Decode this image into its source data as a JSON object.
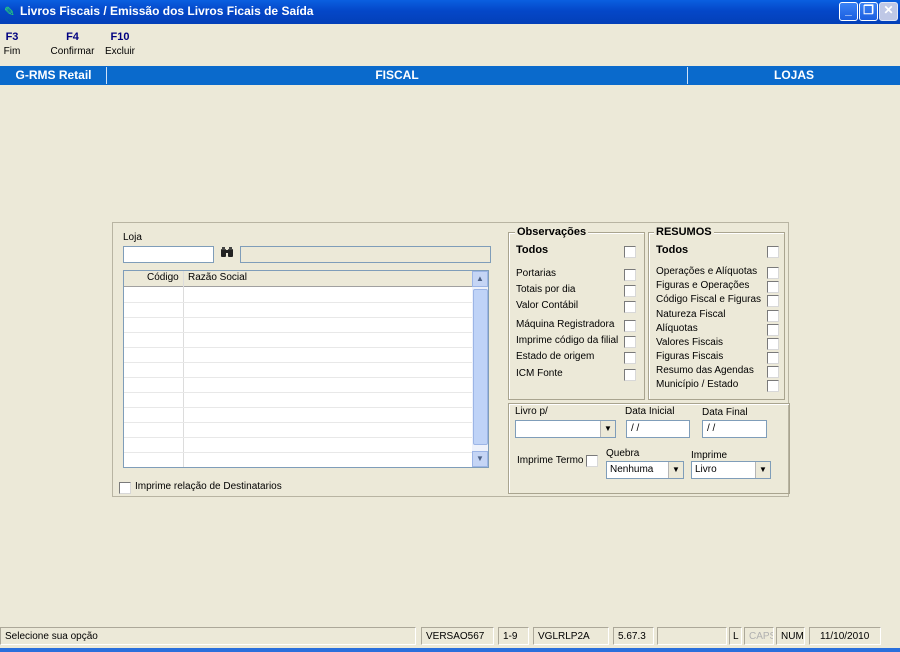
{
  "window": {
    "title": "Livros Fiscais / Emissão dos Livros Ficais de Saída",
    "buttons": {
      "minimize": "_",
      "restore": "❐",
      "close": "✕"
    }
  },
  "toolbar": [
    {
      "key": "F3",
      "label": "Fim"
    },
    {
      "key": "F4",
      "label": "Confirmar"
    },
    {
      "key": "F10",
      "label": "Excluir"
    }
  ],
  "header": {
    "left": "G-RMS Retail",
    "center": "FISCAL",
    "right": "LOJAS"
  },
  "loja": {
    "label": "Loja",
    "code_value": "",
    "name_value": "",
    "search_icon": "binoculars-icon",
    "columns": [
      "Código",
      "Razão Social"
    ],
    "rows": [],
    "imprime_destinatarios_label": "Imprime relação de Destinatarios",
    "imprime_destinatarios_checked": false
  },
  "observacoes": {
    "title": "Observações",
    "todos_label": "Todos",
    "items": [
      {
        "label": "Portarias",
        "checked": false
      },
      {
        "label": "Totais por dia",
        "checked": false
      },
      {
        "label": "Valor Contábil",
        "checked": false
      },
      {
        "label": "Máquina Registradora",
        "checked": false
      },
      {
        "label": "Imprime código da filial",
        "checked": false
      },
      {
        "label": "Estado de origem",
        "checked": false
      },
      {
        "label": "ICM Fonte",
        "checked": false
      }
    ]
  },
  "resumos": {
    "title": "RESUMOS",
    "todos_label": "Todos",
    "items": [
      {
        "label": "Operações e Alíquotas",
        "checked": false
      },
      {
        "label": "Figuras e Operações",
        "checked": false
      },
      {
        "label": "Código Fiscal e Figuras",
        "checked": false
      },
      {
        "label": "Natureza Fiscal",
        "checked": false
      },
      {
        "label": "Alíquotas",
        "checked": false
      },
      {
        "label": "Valores Fiscais",
        "checked": false
      },
      {
        "label": "Figuras Fiscais",
        "checked": false
      },
      {
        "label": "Resumo das Agendas",
        "checked": false
      },
      {
        "label": "Município / Estado",
        "checked": false
      }
    ]
  },
  "livro": {
    "livro_label": "Livro p/",
    "livro_value": "",
    "data_inicial_label": "Data Inicial",
    "data_inicial_value": "/ /",
    "data_final_label": "Data Final",
    "data_final_value": "/ /",
    "imprime_termo_label": "Imprime Termo",
    "imprime_termo_checked": false,
    "quebra_label": "Quebra",
    "quebra_value": "Nenhuma",
    "imprime_label": "Imprime",
    "imprime_value": "Livro"
  },
  "status": {
    "message": "Selecione sua opção",
    "versao": "VERSAO567",
    "range": "1-9",
    "program": "VGLRLP2A",
    "build": "5.67.3",
    "blank": "",
    "l": "L",
    "caps": "CAPS",
    "num": "NUM",
    "date": "11/10/2010"
  },
  "colors": {
    "title_bar": "#0447C8",
    "header_bar": "#0A6ACC",
    "background": "#ECE9D8",
    "key_text": "#000080"
  }
}
